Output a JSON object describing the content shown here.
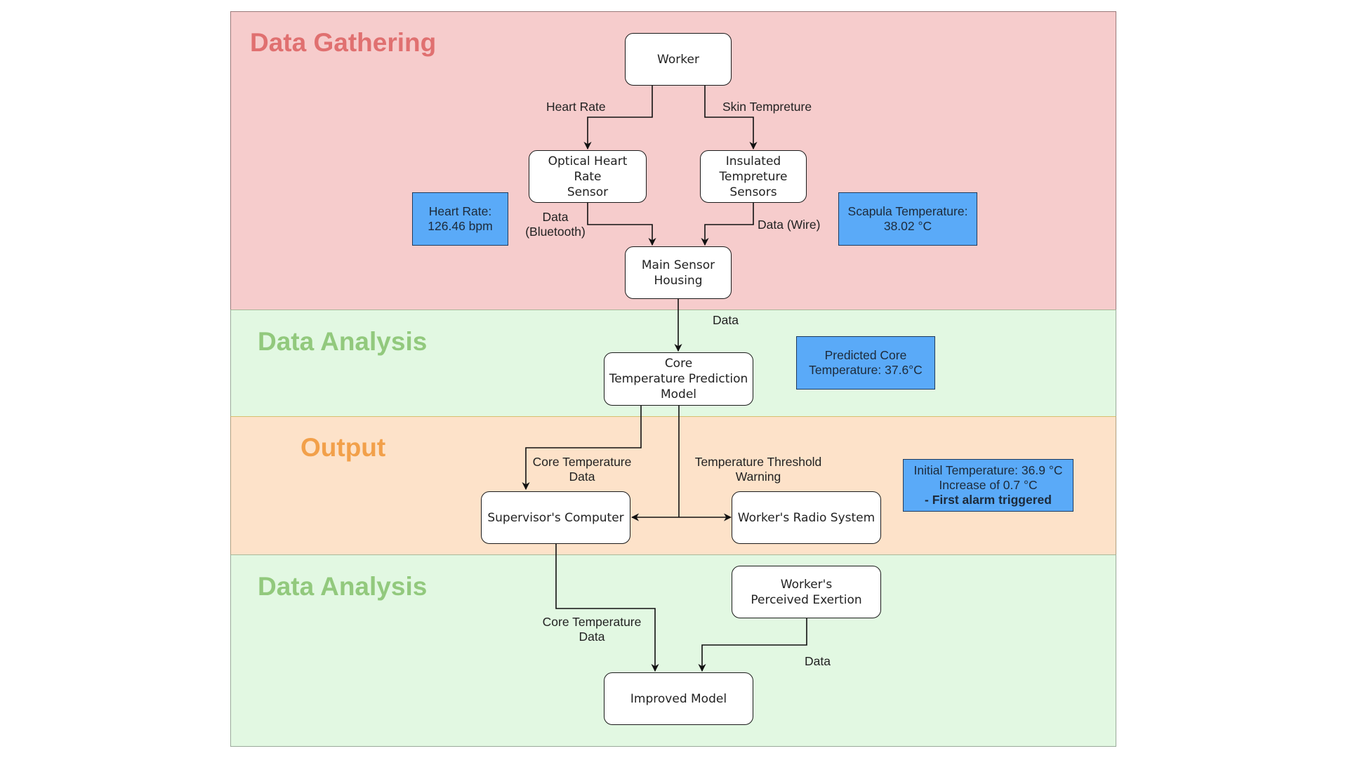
{
  "colors": {
    "data_gathering_bg": "#f6cccc",
    "data_gathering_title": "#e07070",
    "data_analysis_bg": "#e2f8e2",
    "data_analysis_title": "#92c97d",
    "output_bg": "#fde2c9",
    "output_title": "#f2a04a",
    "note_bg": "#5aaaf8"
  },
  "lanes": [
    {
      "id": "data-gathering",
      "title": "Data Gathering"
    },
    {
      "id": "data-analysis-1",
      "title": "Data Analysis"
    },
    {
      "id": "output",
      "title": "Output"
    },
    {
      "id": "data-analysis-2",
      "title": "Data Analysis"
    }
  ],
  "nodes": {
    "worker": "Worker",
    "optical_sensor": "Optical Heart Rate\nSensor",
    "insulated_sensors": "Insulated\nTempreture\nSensors",
    "main_sensor_housing": "Main Sensor\nHousing",
    "core_model": "Core\nTemperature Prediction\nModel",
    "supervisor_computer": "Supervisor's Computer",
    "radio_system": "Worker's Radio System",
    "perceived_exertion": "Worker's\nPerceived Exertion",
    "improved_model": "Improved Model"
  },
  "notes": {
    "heart_rate": "Heart Rate:\n126.46 bpm",
    "scapula": "Scapula Temperature:\n38.02 °C",
    "predicted_core": "Predicted Core\nTemperature: 37.6°C",
    "alarm_line1": "Initial Temperature: 36.9 °C",
    "alarm_line2": "Increase of 0.7 °C",
    "alarm_line3": "- First alarm triggered"
  },
  "edge_labels": {
    "heart_rate": "Heart Rate",
    "skin_temp": "Skin Tempreture",
    "data_bluetooth": "Data\n(Bluetooth)",
    "data_wire": "Data (Wire)",
    "data_to_model": "Data",
    "core_temp_data_1": "Core Temperature\nData",
    "threshold_warning": "Temperature Threshold\nWarning",
    "core_temp_data_2": "Core Temperature\nData",
    "data_exertion": "Data"
  }
}
